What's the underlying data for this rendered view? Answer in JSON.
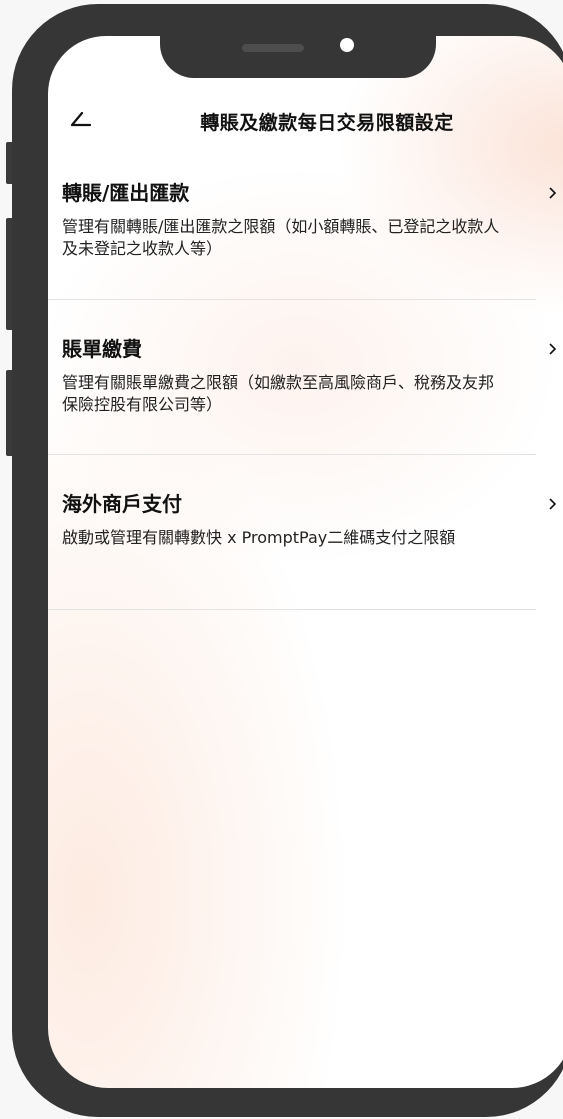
{
  "header": {
    "title": "轉賬及繳款每日交易限額設定",
    "back_icon": "back-arrow-icon"
  },
  "items": [
    {
      "title": "轉賬/匯出匯款",
      "description": "管理有關轉賬/匯出匯款之限額（如小額轉賬、已登記之收款人及未登記之收款人等）",
      "icon": "chevron-right-icon"
    },
    {
      "title": "賬單繳費",
      "description": "管理有關賬單繳費之限額（如繳款至高風險商戶、稅務及友邦保險控股有限公司等）",
      "icon": "chevron-right-icon"
    },
    {
      "title": "海外商戶支付",
      "description": "啟動或管理有關轉數快 x PromptPay二維碼支付之限額",
      "icon": "chevron-right-icon"
    }
  ],
  "colors": {
    "frame": "#363636",
    "screen_bg": "#ffffff",
    "text": "#111111",
    "divider": "#e3e3e3"
  }
}
